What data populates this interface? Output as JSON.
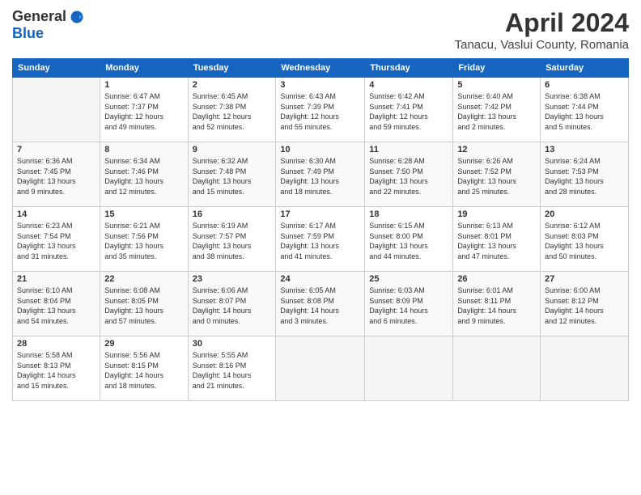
{
  "logo": {
    "general": "General",
    "blue": "Blue"
  },
  "title": "April 2024",
  "subtitle": "Tanacu, Vaslui County, Romania",
  "days_of_week": [
    "Sunday",
    "Monday",
    "Tuesday",
    "Wednesday",
    "Thursday",
    "Friday",
    "Saturday"
  ],
  "weeks": [
    [
      {
        "num": "",
        "detail": ""
      },
      {
        "num": "1",
        "detail": "Sunrise: 6:47 AM\nSunset: 7:37 PM\nDaylight: 12 hours\nand 49 minutes."
      },
      {
        "num": "2",
        "detail": "Sunrise: 6:45 AM\nSunset: 7:38 PM\nDaylight: 12 hours\nand 52 minutes."
      },
      {
        "num": "3",
        "detail": "Sunrise: 6:43 AM\nSunset: 7:39 PM\nDaylight: 12 hours\nand 55 minutes."
      },
      {
        "num": "4",
        "detail": "Sunrise: 6:42 AM\nSunset: 7:41 PM\nDaylight: 12 hours\nand 59 minutes."
      },
      {
        "num": "5",
        "detail": "Sunrise: 6:40 AM\nSunset: 7:42 PM\nDaylight: 13 hours\nand 2 minutes."
      },
      {
        "num": "6",
        "detail": "Sunrise: 6:38 AM\nSunset: 7:44 PM\nDaylight: 13 hours\nand 5 minutes."
      }
    ],
    [
      {
        "num": "7",
        "detail": "Sunrise: 6:36 AM\nSunset: 7:45 PM\nDaylight: 13 hours\nand 9 minutes."
      },
      {
        "num": "8",
        "detail": "Sunrise: 6:34 AM\nSunset: 7:46 PM\nDaylight: 13 hours\nand 12 minutes."
      },
      {
        "num": "9",
        "detail": "Sunrise: 6:32 AM\nSunset: 7:48 PM\nDaylight: 13 hours\nand 15 minutes."
      },
      {
        "num": "10",
        "detail": "Sunrise: 6:30 AM\nSunset: 7:49 PM\nDaylight: 13 hours\nand 18 minutes."
      },
      {
        "num": "11",
        "detail": "Sunrise: 6:28 AM\nSunset: 7:50 PM\nDaylight: 13 hours\nand 22 minutes."
      },
      {
        "num": "12",
        "detail": "Sunrise: 6:26 AM\nSunset: 7:52 PM\nDaylight: 13 hours\nand 25 minutes."
      },
      {
        "num": "13",
        "detail": "Sunrise: 6:24 AM\nSunset: 7:53 PM\nDaylight: 13 hours\nand 28 minutes."
      }
    ],
    [
      {
        "num": "14",
        "detail": "Sunrise: 6:23 AM\nSunset: 7:54 PM\nDaylight: 13 hours\nand 31 minutes."
      },
      {
        "num": "15",
        "detail": "Sunrise: 6:21 AM\nSunset: 7:56 PM\nDaylight: 13 hours\nand 35 minutes."
      },
      {
        "num": "16",
        "detail": "Sunrise: 6:19 AM\nSunset: 7:57 PM\nDaylight: 13 hours\nand 38 minutes."
      },
      {
        "num": "17",
        "detail": "Sunrise: 6:17 AM\nSunset: 7:59 PM\nDaylight: 13 hours\nand 41 minutes."
      },
      {
        "num": "18",
        "detail": "Sunrise: 6:15 AM\nSunset: 8:00 PM\nDaylight: 13 hours\nand 44 minutes."
      },
      {
        "num": "19",
        "detail": "Sunrise: 6:13 AM\nSunset: 8:01 PM\nDaylight: 13 hours\nand 47 minutes."
      },
      {
        "num": "20",
        "detail": "Sunrise: 6:12 AM\nSunset: 8:03 PM\nDaylight: 13 hours\nand 50 minutes."
      }
    ],
    [
      {
        "num": "21",
        "detail": "Sunrise: 6:10 AM\nSunset: 8:04 PM\nDaylight: 13 hours\nand 54 minutes."
      },
      {
        "num": "22",
        "detail": "Sunrise: 6:08 AM\nSunset: 8:05 PM\nDaylight: 13 hours\nand 57 minutes."
      },
      {
        "num": "23",
        "detail": "Sunrise: 6:06 AM\nSunset: 8:07 PM\nDaylight: 14 hours\nand 0 minutes."
      },
      {
        "num": "24",
        "detail": "Sunrise: 6:05 AM\nSunset: 8:08 PM\nDaylight: 14 hours\nand 3 minutes."
      },
      {
        "num": "25",
        "detail": "Sunrise: 6:03 AM\nSunset: 8:09 PM\nDaylight: 14 hours\nand 6 minutes."
      },
      {
        "num": "26",
        "detail": "Sunrise: 6:01 AM\nSunset: 8:11 PM\nDaylight: 14 hours\nand 9 minutes."
      },
      {
        "num": "27",
        "detail": "Sunrise: 6:00 AM\nSunset: 8:12 PM\nDaylight: 14 hours\nand 12 minutes."
      }
    ],
    [
      {
        "num": "28",
        "detail": "Sunrise: 5:58 AM\nSunset: 8:13 PM\nDaylight: 14 hours\nand 15 minutes."
      },
      {
        "num": "29",
        "detail": "Sunrise: 5:56 AM\nSunset: 8:15 PM\nDaylight: 14 hours\nand 18 minutes."
      },
      {
        "num": "30",
        "detail": "Sunrise: 5:55 AM\nSunset: 8:16 PM\nDaylight: 14 hours\nand 21 minutes."
      },
      {
        "num": "",
        "detail": ""
      },
      {
        "num": "",
        "detail": ""
      },
      {
        "num": "",
        "detail": ""
      },
      {
        "num": "",
        "detail": ""
      }
    ]
  ]
}
